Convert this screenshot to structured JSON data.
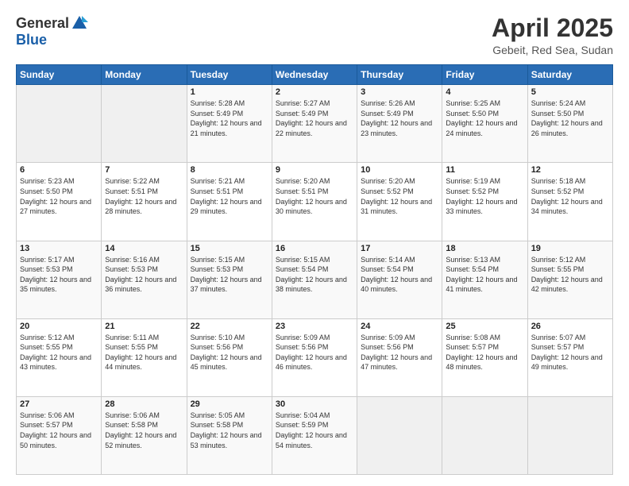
{
  "header": {
    "logo_general": "General",
    "logo_blue": "Blue",
    "title": "April 2025",
    "location": "Gebeit, Red Sea, Sudan"
  },
  "weekdays": [
    "Sunday",
    "Monday",
    "Tuesday",
    "Wednesday",
    "Thursday",
    "Friday",
    "Saturday"
  ],
  "weeks": [
    [
      {
        "day": "",
        "sunrise": "",
        "sunset": "",
        "daylight": ""
      },
      {
        "day": "",
        "sunrise": "",
        "sunset": "",
        "daylight": ""
      },
      {
        "day": "1",
        "sunrise": "Sunrise: 5:28 AM",
        "sunset": "Sunset: 5:49 PM",
        "daylight": "Daylight: 12 hours and 21 minutes."
      },
      {
        "day": "2",
        "sunrise": "Sunrise: 5:27 AM",
        "sunset": "Sunset: 5:49 PM",
        "daylight": "Daylight: 12 hours and 22 minutes."
      },
      {
        "day": "3",
        "sunrise": "Sunrise: 5:26 AM",
        "sunset": "Sunset: 5:49 PM",
        "daylight": "Daylight: 12 hours and 23 minutes."
      },
      {
        "day": "4",
        "sunrise": "Sunrise: 5:25 AM",
        "sunset": "Sunset: 5:50 PM",
        "daylight": "Daylight: 12 hours and 24 minutes."
      },
      {
        "day": "5",
        "sunrise": "Sunrise: 5:24 AM",
        "sunset": "Sunset: 5:50 PM",
        "daylight": "Daylight: 12 hours and 26 minutes."
      }
    ],
    [
      {
        "day": "6",
        "sunrise": "Sunrise: 5:23 AM",
        "sunset": "Sunset: 5:50 PM",
        "daylight": "Daylight: 12 hours and 27 minutes."
      },
      {
        "day": "7",
        "sunrise": "Sunrise: 5:22 AM",
        "sunset": "Sunset: 5:51 PM",
        "daylight": "Daylight: 12 hours and 28 minutes."
      },
      {
        "day": "8",
        "sunrise": "Sunrise: 5:21 AM",
        "sunset": "Sunset: 5:51 PM",
        "daylight": "Daylight: 12 hours and 29 minutes."
      },
      {
        "day": "9",
        "sunrise": "Sunrise: 5:20 AM",
        "sunset": "Sunset: 5:51 PM",
        "daylight": "Daylight: 12 hours and 30 minutes."
      },
      {
        "day": "10",
        "sunrise": "Sunrise: 5:20 AM",
        "sunset": "Sunset: 5:52 PM",
        "daylight": "Daylight: 12 hours and 31 minutes."
      },
      {
        "day": "11",
        "sunrise": "Sunrise: 5:19 AM",
        "sunset": "Sunset: 5:52 PM",
        "daylight": "Daylight: 12 hours and 33 minutes."
      },
      {
        "day": "12",
        "sunrise": "Sunrise: 5:18 AM",
        "sunset": "Sunset: 5:52 PM",
        "daylight": "Daylight: 12 hours and 34 minutes."
      }
    ],
    [
      {
        "day": "13",
        "sunrise": "Sunrise: 5:17 AM",
        "sunset": "Sunset: 5:53 PM",
        "daylight": "Daylight: 12 hours and 35 minutes."
      },
      {
        "day": "14",
        "sunrise": "Sunrise: 5:16 AM",
        "sunset": "Sunset: 5:53 PM",
        "daylight": "Daylight: 12 hours and 36 minutes."
      },
      {
        "day": "15",
        "sunrise": "Sunrise: 5:15 AM",
        "sunset": "Sunset: 5:53 PM",
        "daylight": "Daylight: 12 hours and 37 minutes."
      },
      {
        "day": "16",
        "sunrise": "Sunrise: 5:15 AM",
        "sunset": "Sunset: 5:54 PM",
        "daylight": "Daylight: 12 hours and 38 minutes."
      },
      {
        "day": "17",
        "sunrise": "Sunrise: 5:14 AM",
        "sunset": "Sunset: 5:54 PM",
        "daylight": "Daylight: 12 hours and 40 minutes."
      },
      {
        "day": "18",
        "sunrise": "Sunrise: 5:13 AM",
        "sunset": "Sunset: 5:54 PM",
        "daylight": "Daylight: 12 hours and 41 minutes."
      },
      {
        "day": "19",
        "sunrise": "Sunrise: 5:12 AM",
        "sunset": "Sunset: 5:55 PM",
        "daylight": "Daylight: 12 hours and 42 minutes."
      }
    ],
    [
      {
        "day": "20",
        "sunrise": "Sunrise: 5:12 AM",
        "sunset": "Sunset: 5:55 PM",
        "daylight": "Daylight: 12 hours and 43 minutes."
      },
      {
        "day": "21",
        "sunrise": "Sunrise: 5:11 AM",
        "sunset": "Sunset: 5:55 PM",
        "daylight": "Daylight: 12 hours and 44 minutes."
      },
      {
        "day": "22",
        "sunrise": "Sunrise: 5:10 AM",
        "sunset": "Sunset: 5:56 PM",
        "daylight": "Daylight: 12 hours and 45 minutes."
      },
      {
        "day": "23",
        "sunrise": "Sunrise: 5:09 AM",
        "sunset": "Sunset: 5:56 PM",
        "daylight": "Daylight: 12 hours and 46 minutes."
      },
      {
        "day": "24",
        "sunrise": "Sunrise: 5:09 AM",
        "sunset": "Sunset: 5:56 PM",
        "daylight": "Daylight: 12 hours and 47 minutes."
      },
      {
        "day": "25",
        "sunrise": "Sunrise: 5:08 AM",
        "sunset": "Sunset: 5:57 PM",
        "daylight": "Daylight: 12 hours and 48 minutes."
      },
      {
        "day": "26",
        "sunrise": "Sunrise: 5:07 AM",
        "sunset": "Sunset: 5:57 PM",
        "daylight": "Daylight: 12 hours and 49 minutes."
      }
    ],
    [
      {
        "day": "27",
        "sunrise": "Sunrise: 5:06 AM",
        "sunset": "Sunset: 5:57 PM",
        "daylight": "Daylight: 12 hours and 50 minutes."
      },
      {
        "day": "28",
        "sunrise": "Sunrise: 5:06 AM",
        "sunset": "Sunset: 5:58 PM",
        "daylight": "Daylight: 12 hours and 52 minutes."
      },
      {
        "day": "29",
        "sunrise": "Sunrise: 5:05 AM",
        "sunset": "Sunset: 5:58 PM",
        "daylight": "Daylight: 12 hours and 53 minutes."
      },
      {
        "day": "30",
        "sunrise": "Sunrise: 5:04 AM",
        "sunset": "Sunset: 5:59 PM",
        "daylight": "Daylight: 12 hours and 54 minutes."
      },
      {
        "day": "",
        "sunrise": "",
        "sunset": "",
        "daylight": ""
      },
      {
        "day": "",
        "sunrise": "",
        "sunset": "",
        "daylight": ""
      },
      {
        "day": "",
        "sunrise": "",
        "sunset": "",
        "daylight": ""
      }
    ]
  ]
}
